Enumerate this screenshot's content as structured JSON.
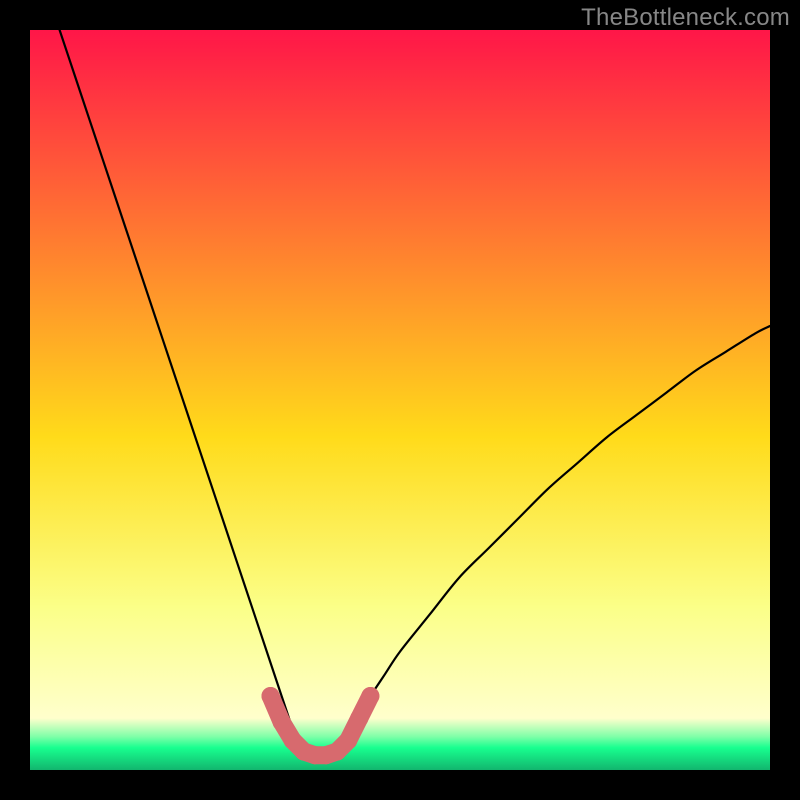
{
  "watermark": "TheBottleneck.com",
  "colors": {
    "frame": "#000000",
    "gradient_top": "#ff1648",
    "gradient_mid": "#ffdb1a",
    "gradient_low": "#fbff88",
    "gradient_band": "#18ff8f",
    "gradient_bottom": "#12b56e",
    "curve": "#000000",
    "marker": "#d76a6e"
  },
  "chart_data": {
    "type": "line",
    "title": "",
    "xlabel": "",
    "ylabel": "",
    "xlim": [
      0,
      100
    ],
    "ylim": [
      0,
      100
    ],
    "grid": false,
    "legend": false,
    "series": [
      {
        "name": "bottleneck-curve",
        "x": [
          4,
          6,
          8,
          10,
          12,
          14,
          16,
          18,
          20,
          22,
          24,
          26,
          28,
          30,
          32,
          34,
          35,
          36,
          37,
          38,
          39,
          40,
          41,
          42,
          44,
          46,
          48,
          50,
          54,
          58,
          62,
          66,
          70,
          74,
          78,
          82,
          86,
          90,
          94,
          98,
          100
        ],
        "y": [
          100,
          94,
          88,
          82,
          76,
          70,
          64,
          58,
          52,
          46,
          40,
          34,
          28,
          22,
          16,
          10,
          7,
          4,
          2.5,
          2,
          2,
          2,
          2.5,
          4,
          7,
          10,
          13,
          16,
          21,
          26,
          30,
          34,
          38,
          41.5,
          45,
          48,
          51,
          54,
          56.5,
          59,
          60
        ]
      }
    ],
    "markers": {
      "name": "valley-markers",
      "points": [
        {
          "x": 32.5,
          "y": 10
        },
        {
          "x": 34,
          "y": 6.5
        },
        {
          "x": 35.5,
          "y": 4
        },
        {
          "x": 37,
          "y": 2.5
        },
        {
          "x": 38.5,
          "y": 2
        },
        {
          "x": 40,
          "y": 2
        },
        {
          "x": 41.5,
          "y": 2.5
        },
        {
          "x": 43,
          "y": 4
        },
        {
          "x": 44.5,
          "y": 7
        },
        {
          "x": 46,
          "y": 10
        }
      ]
    }
  }
}
